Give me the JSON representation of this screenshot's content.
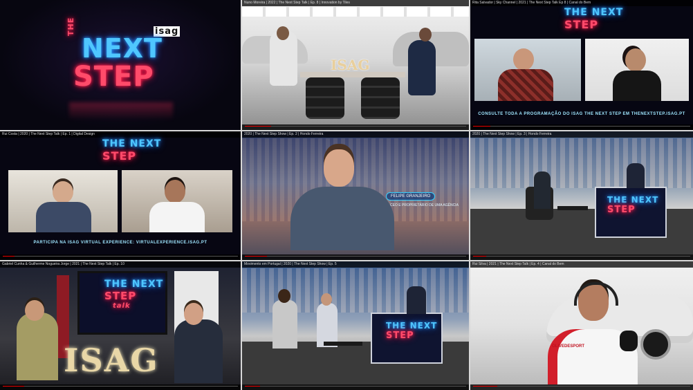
{
  "tiles": [
    {
      "id": "t1",
      "title_bar": "",
      "logo": {
        "brand": "isag",
        "line1": "THE",
        "line2": "NEXT",
        "line3": "STEP"
      }
    },
    {
      "id": "t2",
      "title_bar": "Nuno Moreira | 2022 | The Next Step Talk | Ep. 8 | Innovation by Tiles",
      "sign": "ISAG"
    },
    {
      "id": "t3",
      "title_bar": "Rita Salvador | Sky Channel | 2021 | The Next Step Talk Ep 8 | Canal do Bem",
      "logo": {
        "brand": "isag",
        "line1": "THE NEXT",
        "line2": "STEP"
      },
      "caption": "CONSULTE TODA A PROGRAMAÇÃO DO ISAG THE NEXT STEP EM THENEXTSTEP.ISAG.PT"
    },
    {
      "id": "t4",
      "title_bar": "Rui Costa | 2020 | The Next Step Talk | Ep. 1 | Digital Design",
      "logo": {
        "brand": "isag",
        "line1": "THE NEXT",
        "line2": "STEP"
      },
      "caption": "PARTICIPA NA ISAG VIRTUAL EXPERIENCE: VIRTUALEXPERIENCE.ISAG.PT"
    },
    {
      "id": "t5",
      "title_bar": "2020 | The Next Step Show | Ep. 2 | Hondo Ferreira",
      "name_tag": "FELIPE GRANJEIRO",
      "name_sub": "CEO E PROPRIETÁRIO DE UMA AGÊNCIA"
    },
    {
      "id": "t6",
      "title_bar": "2020 | The Next Step Show | Ep. 3 | Hondo Ferreira",
      "logo": {
        "brand": "isag",
        "line1": "THE NEXT",
        "line2": "STEP"
      }
    },
    {
      "id": "t7",
      "title_bar": "Gabriel Cunha & Guilherme Nogueira Jorge | 2021 | The Next Step Talk | Ep. 10",
      "logo": {
        "brand": "isag",
        "line1": "THE NEXT",
        "line2": "STEP",
        "line3": "talk"
      },
      "sign": "ISAG"
    },
    {
      "id": "t8",
      "title_bar": "Movimento em Portugal | 2020 | The Next Step Show | Ep. 5",
      "logo": {
        "brand": "isag",
        "line1": "THE NEXT",
        "line2": "STEP"
      }
    },
    {
      "id": "t9",
      "title_bar": "Rui Silva | 2021 | The Next Step Talk | Ep. 4 | Canal do Bem",
      "jacket_text": "OLIVEDESPORT"
    }
  ],
  "colors": {
    "neon_blue": "#4fc6ff",
    "neon_red": "#ff4b6a",
    "progress": "#e00000"
  }
}
